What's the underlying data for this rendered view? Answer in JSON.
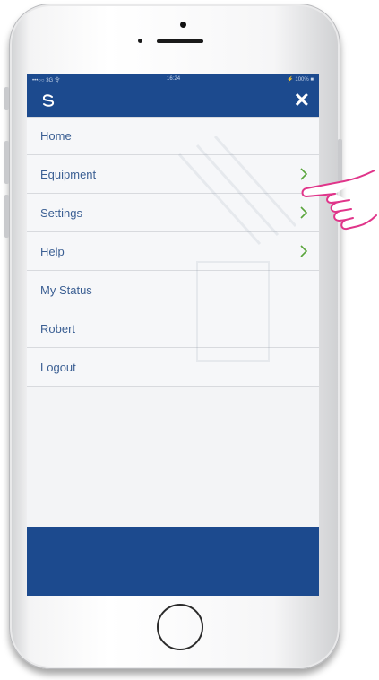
{
  "statusbar": {
    "left": "•••○○ 3G 令",
    "time": "16:24",
    "right": "⚡ 100% ■"
  },
  "navbar": {
    "logo_icon": "swirl-logo-icon",
    "close_label": "✕"
  },
  "menu": {
    "items": [
      {
        "label": "Home",
        "has_chevron": false
      },
      {
        "label": "Equipment",
        "has_chevron": true
      },
      {
        "label": "Settings",
        "has_chevron": true
      },
      {
        "label": "Help",
        "has_chevron": true
      },
      {
        "label": "My Status",
        "has_chevron": false
      },
      {
        "label": "Robert",
        "has_chevron": false
      },
      {
        "label": "Logout",
        "has_chevron": false
      }
    ]
  },
  "colors": {
    "header": "#1c4a8e",
    "menu_text": "#3b5f93",
    "chevron": "#5aa53c",
    "hand_outline": "#e0358a"
  },
  "annotation": {
    "pointer_icon": "pointing-hand-icon"
  }
}
